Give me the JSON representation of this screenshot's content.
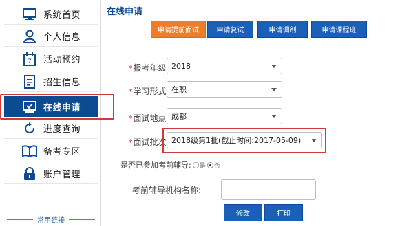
{
  "sidebar": {
    "items": [
      {
        "label": "系统首页",
        "icon": "monitor-icon"
      },
      {
        "label": "个人信息",
        "icon": "user-icon"
      },
      {
        "label": "活动预约",
        "icon": "calendar-icon"
      },
      {
        "label": "招生信息",
        "icon": "document-icon"
      },
      {
        "label": "在线申请",
        "icon": "screen-check-icon",
        "active": true
      },
      {
        "label": "进度查询",
        "icon": "refresh-icon"
      },
      {
        "label": "备考专区",
        "icon": "book-icon"
      },
      {
        "label": "账户管理",
        "icon": "lock-icon"
      }
    ],
    "footer": "常用链接"
  },
  "main": {
    "title": "在线申请",
    "tabs": [
      {
        "label": "申请提前面试",
        "active": true
      },
      {
        "label": "申请复试"
      },
      {
        "label": "申请调剂"
      },
      {
        "label": "申请课程班"
      }
    ],
    "form": {
      "year_label": "报考年级:",
      "year_value": "2018",
      "mode_label": "学习形式:",
      "mode_value": "在职",
      "location_label": "面试地点:",
      "location_value": "成都",
      "batch_label": "面试批次:",
      "batch_value": "2018级第1批(截止时间:2017-05-09)",
      "tutoring_label": "是否已参加考前辅导:",
      "tutoring_yes": "是",
      "tutoring_no": "否",
      "tutoring_selected": "否",
      "org_label": "考前辅导机构名称:",
      "org_value": ""
    },
    "buttons": {
      "edit": "修改",
      "print": "打印"
    }
  },
  "colors": {
    "nav_active": "#0c4b92",
    "tab_active": "#ee7d2a",
    "tab": "#1b5fb8",
    "highlight": "#d23a3a"
  }
}
